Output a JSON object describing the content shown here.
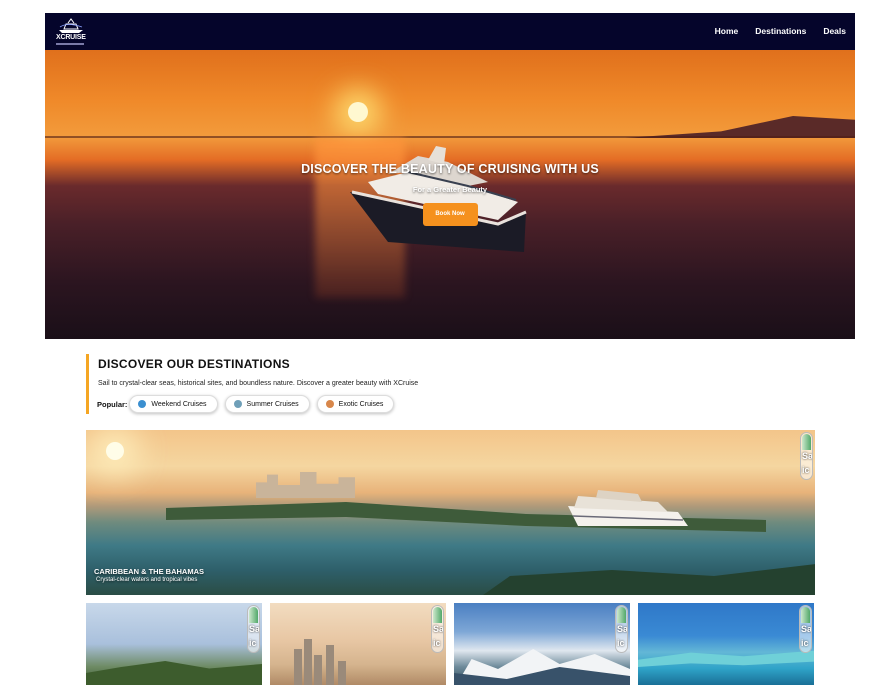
{
  "brand": {
    "name": "XCRUISE"
  },
  "nav": {
    "items": [
      "Home",
      "Destinations",
      "Deals"
    ]
  },
  "hero": {
    "title": "DISCOVER THE BEAUTY OF CRUISING WITH US",
    "subtitle": "For a Greater Beauty",
    "cta": "Book Now"
  },
  "discover": {
    "title": "DISCOVER OUR DESTINATIONS",
    "description": "Sail to crystal-clear seas, historical sites, and boundless nature. Discover a greater beauty with XCruise",
    "popular_label": "Popular:",
    "chips": [
      {
        "label": "Weekend Cruises",
        "color": "#3b8fd0"
      },
      {
        "label": "Summer Cruises",
        "color": "#6f9fb8"
      },
      {
        "label": "Exotic Cruises",
        "color": "#d8874a"
      }
    ]
  },
  "featured": {
    "title": "CARIBBEAN & THE BAHAMAS",
    "subtitle": "Crystal-clear waters and tropical vibes",
    "badge": [
      "Sa",
      "ic"
    ]
  },
  "cards": [
    {
      "badge": [
        "Sa",
        "ic"
      ]
    },
    {
      "badge": [
        "Sa",
        "ic"
      ]
    },
    {
      "badge": [
        "Sa",
        "ic"
      ]
    },
    {
      "badge": [
        "Sa",
        "ic"
      ]
    }
  ],
  "colors": {
    "navbar": "#05052b",
    "accent": "#f5911e",
    "divider": "#f5a623"
  }
}
